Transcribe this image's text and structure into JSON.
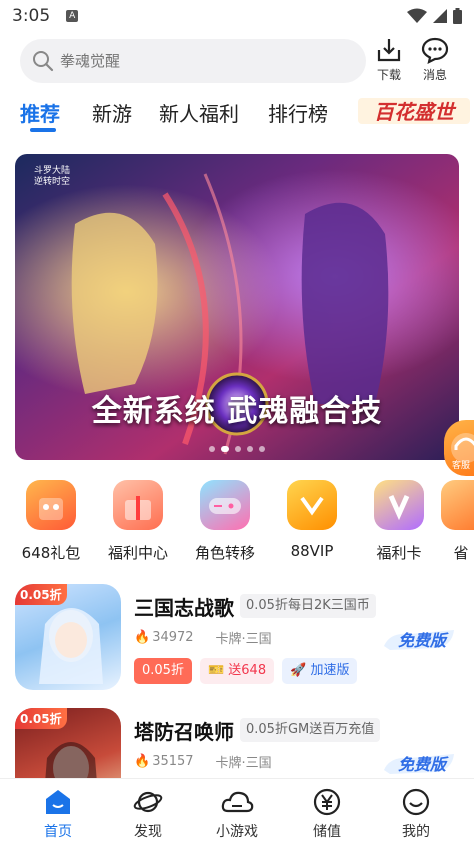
{
  "status_bar": {
    "time": "3:05",
    "notif": "A"
  },
  "header": {
    "search_placeholder": "拳魂觉醒",
    "download_label": "下载",
    "message_label": "消息"
  },
  "tabs": [
    {
      "label": "推荐",
      "active": true
    },
    {
      "label": "新游"
    },
    {
      "label": "新人福利"
    },
    {
      "label": "排行榜"
    }
  ],
  "tab_badge": {
    "label": "百花盛世"
  },
  "banner": {
    "caption": "全新系统 武魂融合技",
    "logo": "斗罗大陆 逆转时空",
    "page_count": 5,
    "active_index": 1
  },
  "float_bubble": {
    "label": "客服"
  },
  "quick_entries": [
    {
      "label": "648礼包",
      "icon": "gift-bag-icon",
      "color": "#ff6b3d"
    },
    {
      "label": "福利中心",
      "icon": "gift-box-icon",
      "color": "#ff7a59"
    },
    {
      "label": "角色转移",
      "icon": "gamepad-icon",
      "color": "#ff5fa2"
    },
    {
      "label": "88VIP",
      "icon": "vip-crown-icon",
      "color": "#ff9f1c"
    },
    {
      "label": "福利卡",
      "icon": "vip-card-icon",
      "color": "#9b5cff"
    },
    {
      "label": "省",
      "icon": "save-icon",
      "color": "#ff8a3d"
    }
  ],
  "games": [
    {
      "name": "三国志战歌",
      "promo": "0.05折每日2K三国币",
      "heat": "34972",
      "category": "卡牌·三国",
      "thumb_tag": "0.05折",
      "chips": [
        "0.05折",
        "送648",
        "加速版"
      ],
      "free_label": "免费版"
    },
    {
      "name": "塔防召唤师",
      "promo": "0.05折GM送百万充值",
      "heat": "35157",
      "category": "卡牌·三国",
      "thumb_tag": "0.05折",
      "free_label": "免费版"
    }
  ],
  "bottom_nav": [
    {
      "label": "首页",
      "icon": "home-icon",
      "active": true
    },
    {
      "label": "发现",
      "icon": "planet-icon"
    },
    {
      "label": "小游戏",
      "icon": "cloud-icon"
    },
    {
      "label": "储值",
      "icon": "yen-coin-icon"
    },
    {
      "label": "我的",
      "icon": "smile-icon"
    }
  ],
  "colors": {
    "accent": "#1a73e8",
    "promo_red": "#ff6b57",
    "fire": "#ff6a2b"
  }
}
